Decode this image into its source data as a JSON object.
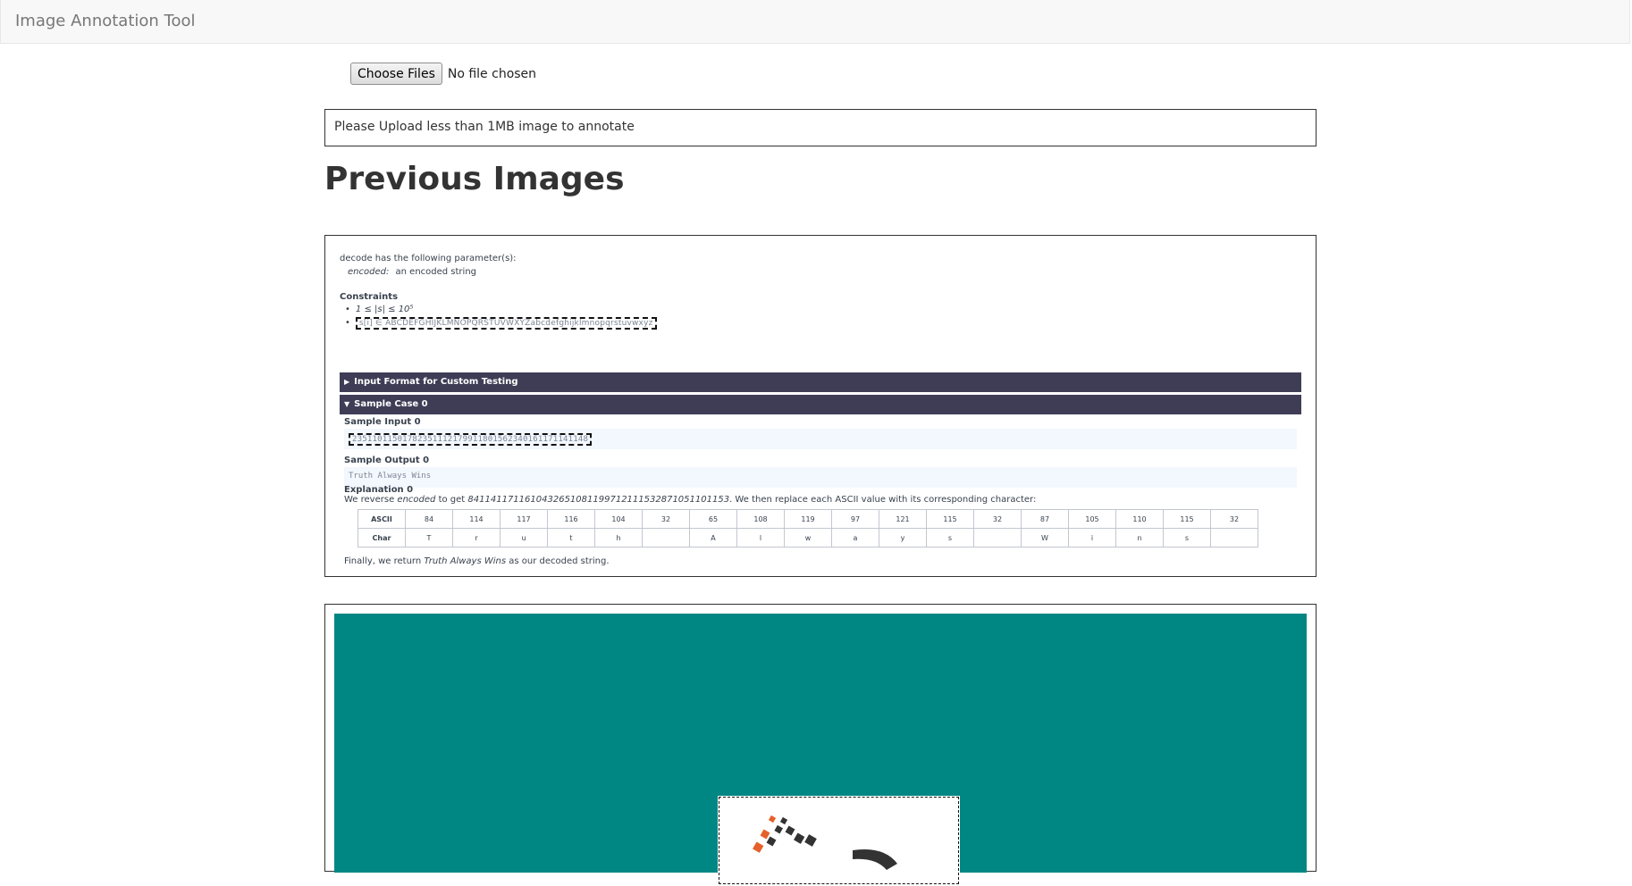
{
  "app": {
    "title": "Image Annotation Tool"
  },
  "upload": {
    "button_label": "Choose Files",
    "status": "No file chosen",
    "notice": "Please Upload less than 1MB image to annotate"
  },
  "page": {
    "heading": "Previous Images"
  },
  "problem": {
    "params_line": "decode has the following parameter(s):",
    "param_name": "encoded:",
    "param_desc": "an encoded string",
    "constraints_heading": "Constraints",
    "constraint_1": "1 ≤ |s| ≤ 10⁵",
    "constraint_2": "s[i] ∈ ABCDEFGHIJKLMNOPQRSTUVWXYZabcdefghijklmnopqrstuvwxyz",
    "input_format_bar": "Input Format for Custom Testing",
    "sample_case_bar": "Sample Case 0",
    "sample_input_heading": "Sample Input 0",
    "sample_input_value": "23511011501782351112179911801562340161171141148",
    "sample_output_heading": "Sample Output 0",
    "sample_output_value": "Truth Always Wins",
    "explanation_heading": "Explanation 0",
    "explanation_pre": "We reverse",
    "explanation_em": "encoded",
    "explanation_mid": "to get",
    "explanation_num": "8411411711610432651081199712111532871051101153",
    "explanation_post": ". We then replace each ASCII value with its corresponding character:",
    "table": {
      "ascii_label": "ASCII",
      "char_label": "Char",
      "ascii": [
        "84",
        "114",
        "117",
        "116",
        "104",
        "32",
        "65",
        "108",
        "119",
        "97",
        "121",
        "115",
        "32",
        "87",
        "105",
        "110",
        "115",
        "32"
      ],
      "chars": [
        "T",
        "r",
        "u",
        "t",
        "h",
        "",
        "A",
        "l",
        "w",
        "a",
        "y",
        "s",
        "",
        "W",
        "i",
        "n",
        "s",
        ""
      ]
    },
    "final_pre": "Finally, we return",
    "final_em": "Truth Always Wins",
    "final_post": "as our decoded string."
  },
  "colors": {
    "bar_bg": "#3f3d56",
    "teal_bg": "#008784",
    "code_bg": "#f3f7fe"
  }
}
